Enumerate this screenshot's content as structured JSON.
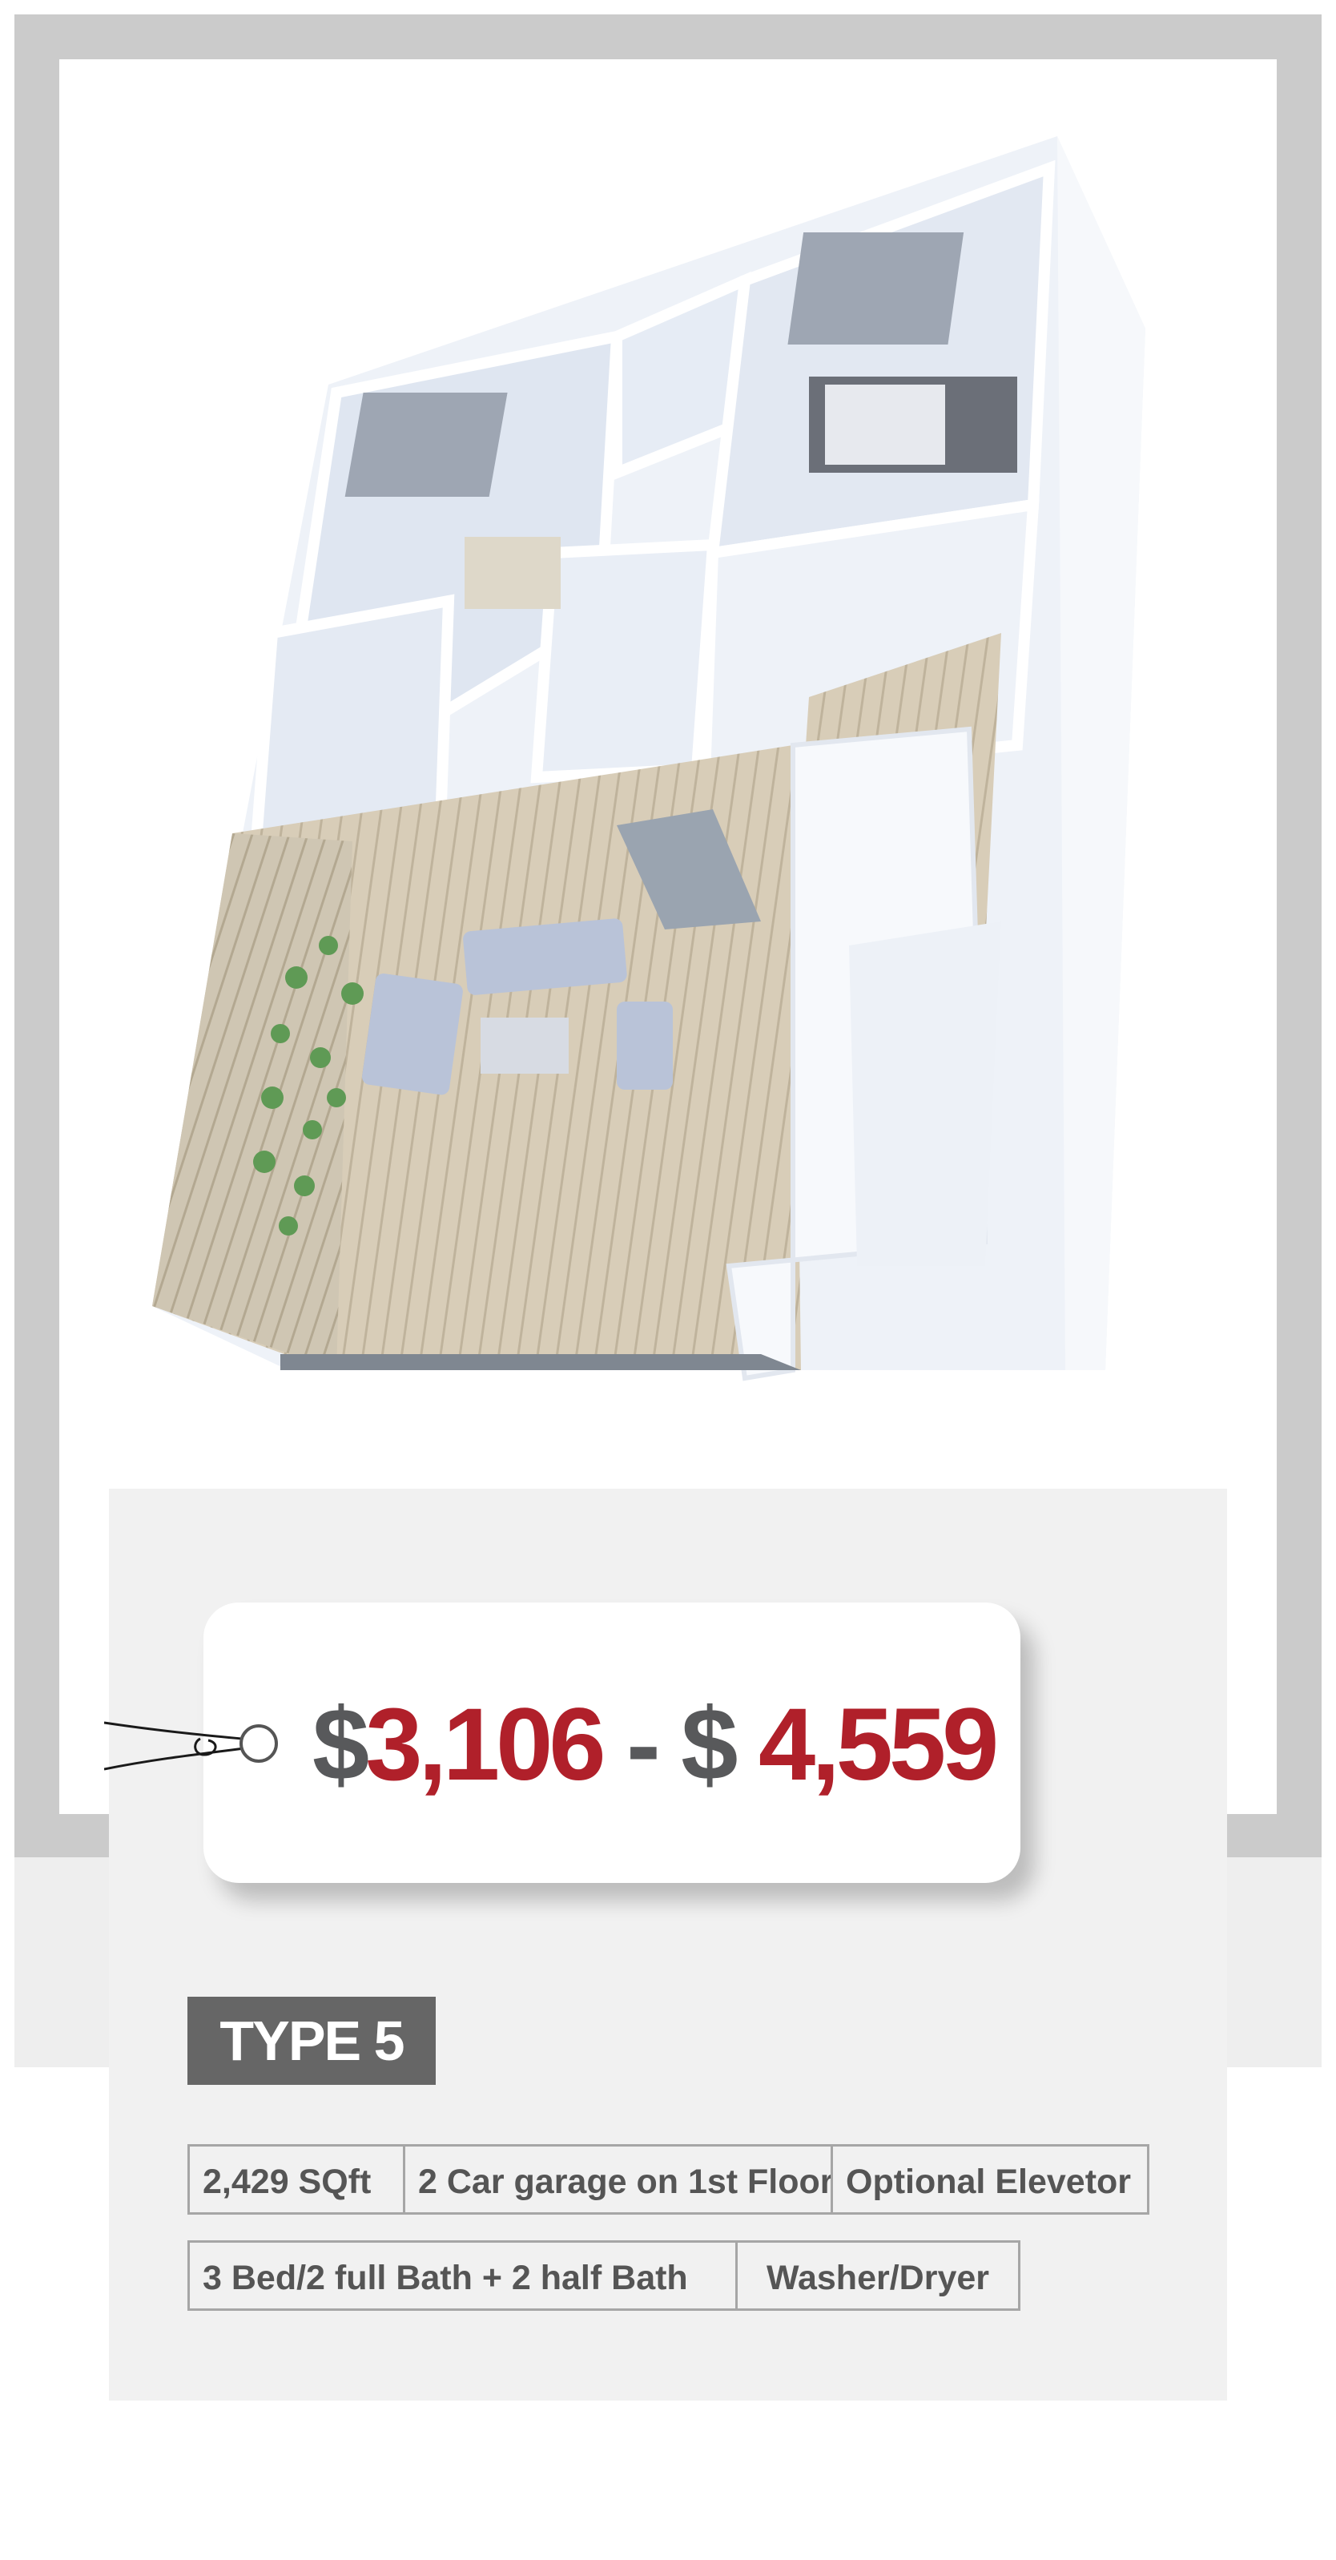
{
  "listing": {
    "price": {
      "currency_symbol": "$",
      "min": "3,106",
      "separator": "-",
      "max": "4,559"
    },
    "type_label": "TYPE 5",
    "features": {
      "row1": [
        "2,429 SQft",
        "2 Car garage on 1st Floor",
        "Optional Elevetor"
      ],
      "row2": [
        "3 Bed/2 full Bath + 2 half Bath",
        "Washer/Dryer"
      ]
    }
  },
  "colors": {
    "price_accent": "#b0202a",
    "text_grey": "#58595b",
    "badge_bg": "#666666",
    "panel_bg": "#f1f1f1",
    "frame_grey": "#cbcbcb"
  }
}
